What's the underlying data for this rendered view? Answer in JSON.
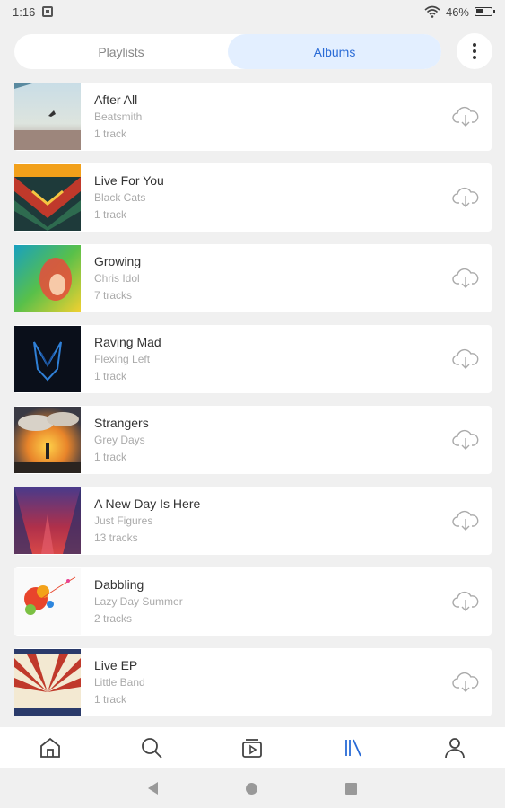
{
  "status_bar": {
    "time": "1:16",
    "battery": "46%"
  },
  "tabs": [
    {
      "label": "Playlists",
      "active": false
    },
    {
      "label": "Albums",
      "active": true
    }
  ],
  "albums": [
    {
      "title": "After All",
      "artist": "Beatsmith",
      "tracks": "1 track"
    },
    {
      "title": "Live For You",
      "artist": "Black Cats",
      "tracks": "1 track"
    },
    {
      "title": "Growing",
      "artist": "Chris Idol",
      "tracks": "7 tracks"
    },
    {
      "title": "Raving Mad",
      "artist": "Flexing Left",
      "tracks": "1 track"
    },
    {
      "title": "Strangers",
      "artist": "Grey Days",
      "tracks": "1 track"
    },
    {
      "title": "A New Day Is Here",
      "artist": "Just Figures",
      "tracks": "13 tracks"
    },
    {
      "title": "Dabbling",
      "artist": "Lazy Day Summer",
      "tracks": "2 tracks"
    },
    {
      "title": "Live EP",
      "artist": "Little Band",
      "tracks": "1 track"
    }
  ],
  "bottom_nav": {
    "items": [
      "home-icon",
      "search-icon",
      "video-icon",
      "library-icon",
      "profile-icon"
    ],
    "active": "library-icon"
  },
  "colors": {
    "accent": "#2a6bd6",
    "tab_active_bg": "#e3efff",
    "background": "#f0f0f0"
  }
}
